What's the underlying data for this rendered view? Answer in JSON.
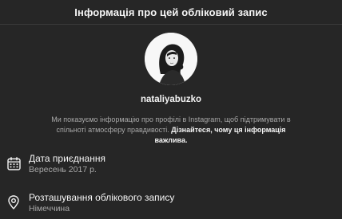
{
  "header": {
    "title": "Інформація про цей обліковий запис"
  },
  "profile": {
    "username": "nataliyabuzko",
    "description": "Ми показуємо інформацію про профілі в Instagram, щоб підтримувати в спільноті атмосферу правдивості.",
    "learn_more": "Дізнайтеся, чому ця інформація важлива."
  },
  "info": {
    "join_date": {
      "label": "Дата приєднання",
      "value": "Вересень 2017 р.",
      "icon": "calendar-icon"
    },
    "location": {
      "label": "Розташування облікового запису",
      "value": "Німеччина",
      "icon": "location-pin-icon"
    }
  }
}
